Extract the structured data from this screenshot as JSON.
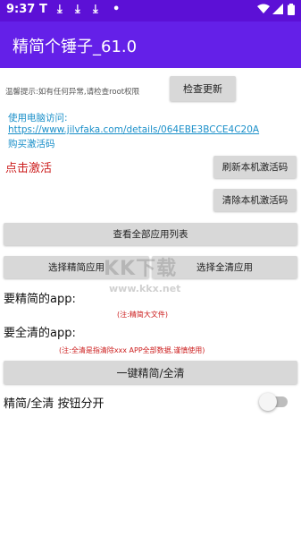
{
  "status_bar": {
    "time": "9:37",
    "notification_glyphs": [
      "T",
      "⤓",
      "⤓",
      "⤓",
      "•"
    ],
    "icons": [
      "wifi-icon",
      "signal-icon",
      "battery-icon"
    ]
  },
  "app_bar": {
    "title": "精简个锤子_61.0"
  },
  "colors": {
    "status_bar": "#5c10d6",
    "app_bar": "#6420e8",
    "link": "#1a8fc9",
    "alert": "#cc1d1d",
    "button": "#d8d8d8"
  },
  "tip": "温馨提示:如有任何异常,请检查root权限",
  "check_update_button": "检查更新",
  "computer_access_label": "使用电脑访问:",
  "computer_access_url": "https://www.jilvfaka.com/details/064EBE3BCCE4C20A",
  "buy_code_link": "购买激活码",
  "click_activate": "点击激活",
  "refresh_code_button": "刷新本机激活码",
  "clear_code_button": "清除本机激活码",
  "view_all_apps_button": "查看全部应用列表",
  "select_slim_button": "选择精简应用",
  "select_clear_button": "选择全清应用",
  "slim_apps_label": "要精简的app:",
  "slim_note": "(注:精简大文件)",
  "clear_apps_label": "要全清的app:",
  "clear_note": "(注:全清是指清除xxx APP全部数据,谨慎使用)",
  "one_click_button": "一键精简/全清",
  "split_toggle_label": "精简/全清 按钮分开",
  "split_toggle_on": false,
  "watermark": {
    "brand": "KK下载",
    "url": "www.kkx.net"
  }
}
